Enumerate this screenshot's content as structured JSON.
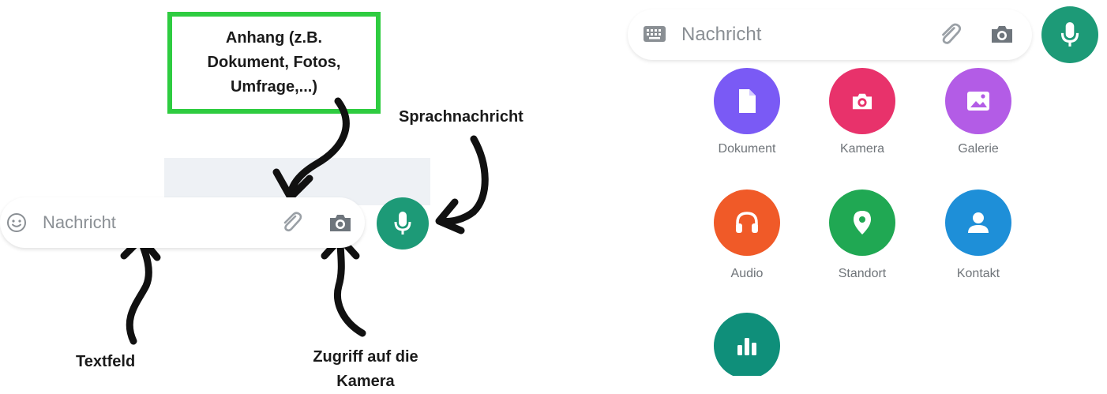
{
  "left": {
    "callout_text": "Anhang (z.B.\nDokument, Fotos,\nUmfrage,...)",
    "compose": {
      "placeholder": "Nachricht"
    },
    "annotations": {
      "voice": "Sprachnachricht",
      "textfield": "Textfeld",
      "camera": "Zugriff auf die\nKamera"
    },
    "colors": {
      "callout_border": "#2ecc40",
      "mic": "#1d9a77"
    }
  },
  "right": {
    "compose": {
      "placeholder": "Nachricht"
    },
    "attachments": [
      {
        "label": "Dokument",
        "color": "#7a5af5",
        "icon": "document-icon"
      },
      {
        "label": "Kamera",
        "color": "#e8326b",
        "icon": "camera-icon"
      },
      {
        "label": "Galerie",
        "color": "#b35ce6",
        "icon": "gallery-icon"
      },
      {
        "label": "Audio",
        "color": "#f05a28",
        "icon": "headphones-icon"
      },
      {
        "label": "Standort",
        "color": "#20a853",
        "icon": "location-pin-icon"
      },
      {
        "label": "Kontakt",
        "color": "#1e8fd8",
        "icon": "contact-icon"
      },
      {
        "label": "",
        "color": "#0f8f7a",
        "icon": "poll-icon"
      }
    ]
  }
}
